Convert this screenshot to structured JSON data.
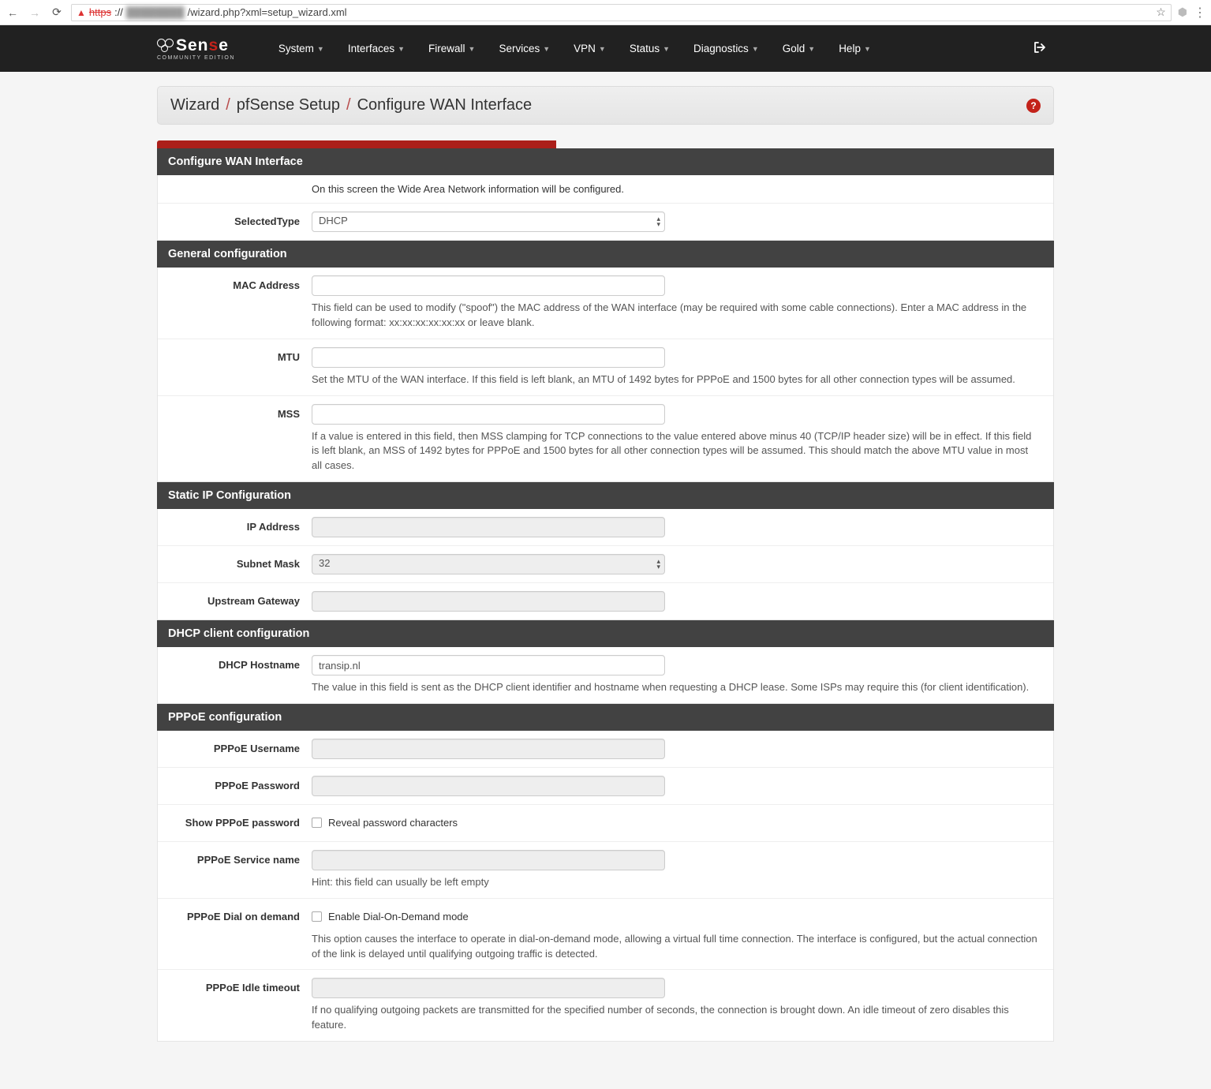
{
  "browser": {
    "url_scheme": "https",
    "url_blur": "████████",
    "url_rest": "/wizard.php?xml=setup_wizard.xml"
  },
  "nav": {
    "brand_main_1": "Sen",
    "brand_main_2": "s",
    "brand_main_3": "e",
    "brand_sub": "COMMUNITY EDITION",
    "items": [
      "System",
      "Interfaces",
      "Firewall",
      "Services",
      "VPN",
      "Status",
      "Diagnostics",
      "Gold",
      "Help"
    ]
  },
  "breadcrumb": {
    "a": "Wizard",
    "b": "pfSense Setup",
    "c": "Configure WAN Interface"
  },
  "sections": {
    "wan": {
      "header": "Configure WAN Interface",
      "intro": "On this screen the Wide Area Network information will be configured.",
      "type_label": "SelectedType",
      "type_value": "DHCP"
    },
    "general": {
      "header": "General configuration",
      "mac_label": "MAC Address",
      "mac_value": "",
      "mac_help": "This field can be used to modify (\"spoof\") the MAC address of the WAN interface (may be required with some cable connections). Enter a MAC address in the following format: xx:xx:xx:xx:xx:xx or leave blank.",
      "mtu_label": "MTU",
      "mtu_value": "",
      "mtu_help": "Set the MTU of the WAN interface. If this field is left blank, an MTU of 1492 bytes for PPPoE and 1500 bytes for all other connection types will be assumed.",
      "mss_label": "MSS",
      "mss_value": "",
      "mss_help": "If a value is entered in this field, then MSS clamping for TCP connections to the value entered above minus 40 (TCP/IP header size) will be in effect. If this field is left blank, an MSS of 1492 bytes for PPPoE and 1500 bytes for all other connection types will be assumed. This should match the above MTU value in most all cases."
    },
    "static": {
      "header": "Static IP Configuration",
      "ip_label": "IP Address",
      "ip_value": "",
      "mask_label": "Subnet Mask",
      "mask_value": "32",
      "gw_label": "Upstream Gateway",
      "gw_value": ""
    },
    "dhcp": {
      "header": "DHCP client configuration",
      "host_label": "DHCP Hostname",
      "host_value": "transip.nl",
      "host_help": "The value in this field is sent as the DHCP client identifier and hostname when requesting a DHCP lease. Some ISPs may require this (for client identification)."
    },
    "pppoe": {
      "header": "PPPoE configuration",
      "user_label": "PPPoE Username",
      "user_value": "",
      "pass_label": "PPPoE Password",
      "pass_value": "",
      "showpass_label": "Show PPPoE password",
      "showpass_text": "Reveal password characters",
      "service_label": "PPPoE Service name",
      "service_value": "",
      "service_help": "Hint: this field can usually be left empty",
      "dod_label": "PPPoE Dial on demand",
      "dod_text": "Enable Dial-On-Demand mode",
      "dod_help": "This option causes the interface to operate in dial-on-demand mode, allowing a virtual full time connection. The interface is configured, but the actual connection of the link is delayed until qualifying outgoing traffic is detected.",
      "idle_label": "PPPoE Idle timeout",
      "idle_value": "",
      "idle_help": "If no qualifying outgoing packets are transmitted for the specified number of seconds, the connection is brought down. An idle timeout of zero disables this feature."
    }
  }
}
